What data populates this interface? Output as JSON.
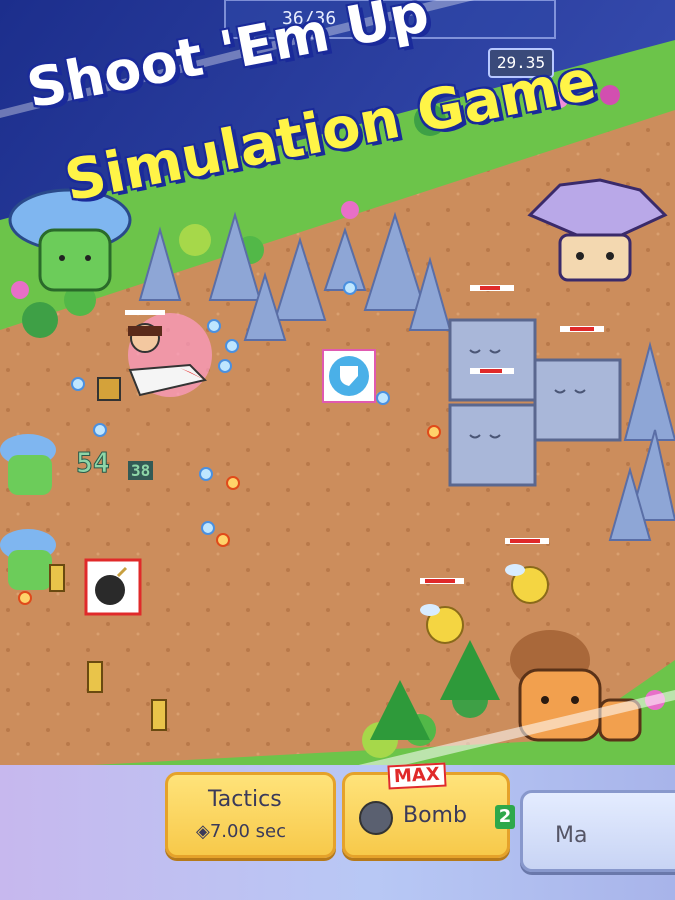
{
  "title": {
    "line1": "Shoot 'Em Up",
    "line2": "Simulation Game"
  },
  "hud": {
    "hp": "36/36",
    "timer": "29.35"
  },
  "damage_numbers": [
    "54",
    "38"
  ],
  "controls": {
    "tactics_label": "Tactics",
    "tactics_time": "◈7.00 sec",
    "bomb_label": "Bomb",
    "bomb_count": "2",
    "bomb_badge": "MAX",
    "third_label": "Ma"
  },
  "colors": {
    "ground": "#cc8d5c",
    "title_white": "#ffffff",
    "title_yellow": "#fff447",
    "outline": "#1a2a9a",
    "button": "#f7c94a"
  }
}
